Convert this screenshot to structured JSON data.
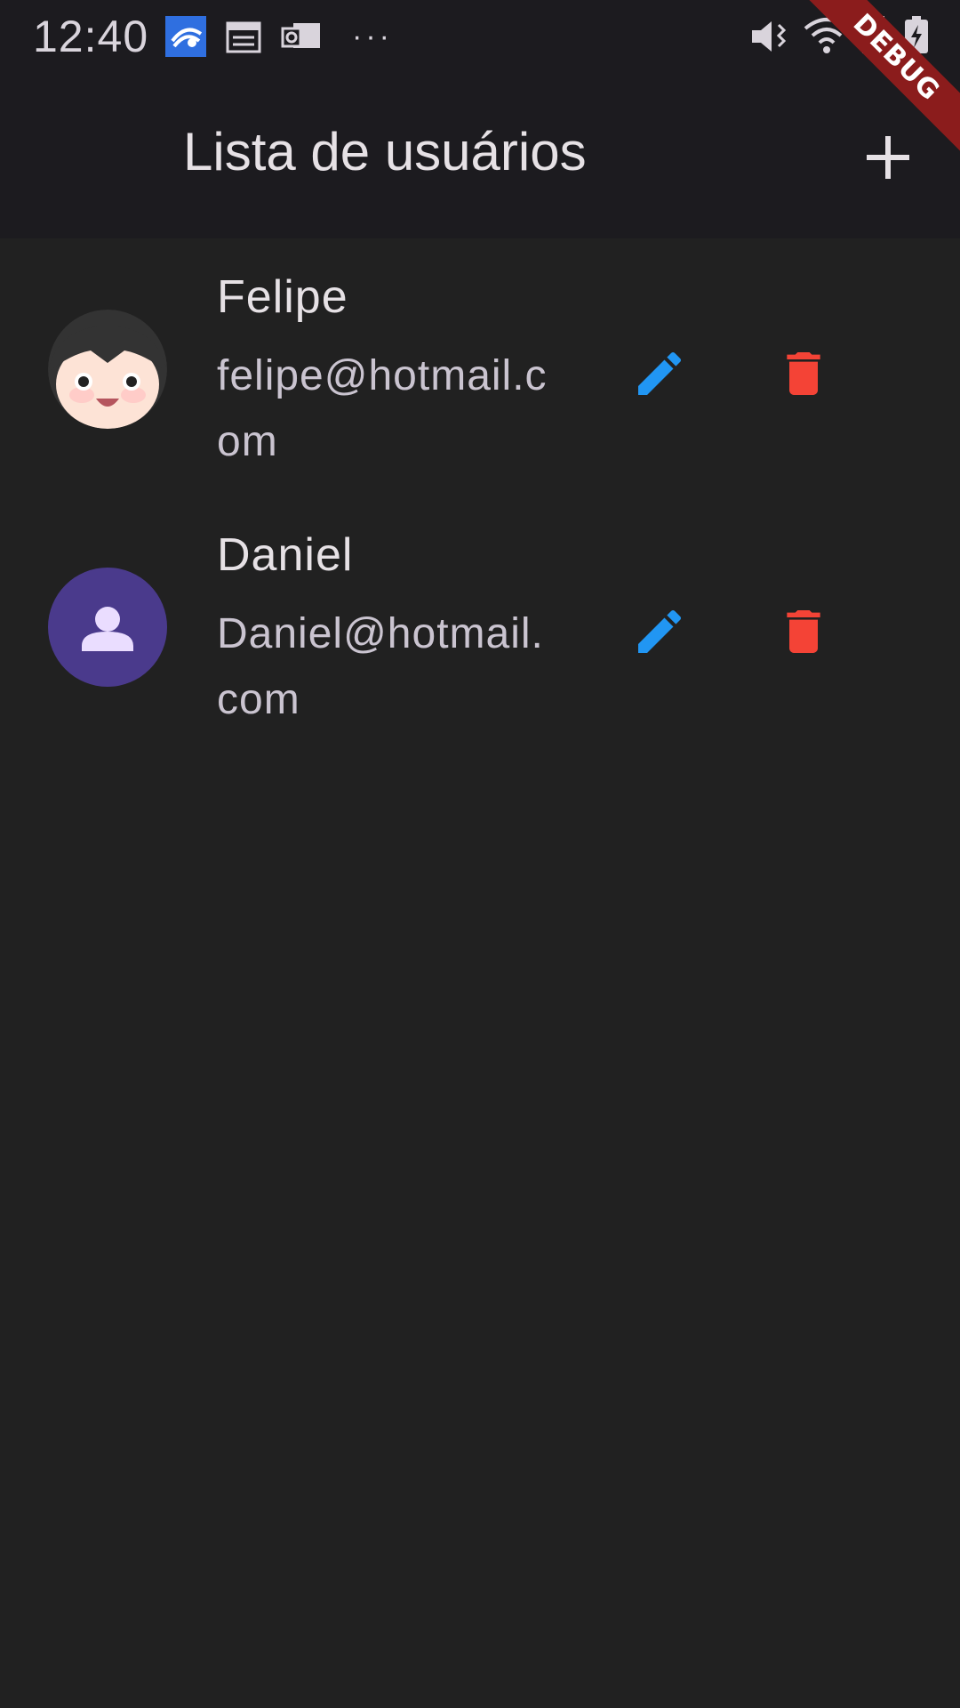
{
  "status_bar": {
    "time": "12:40",
    "left_icons": [
      "browser-app-icon",
      "calendar-icon",
      "outlook-icon",
      "more-dots-icon"
    ],
    "right_icons": [
      "mute-vibrate-icon",
      "wifi-icon",
      "signal-icon",
      "battery-charging-icon"
    ]
  },
  "app_bar": {
    "title": "Lista de usuários",
    "add_icon": "plus-icon"
  },
  "users": [
    {
      "name": "Felipe",
      "email": "felipe@hotmail.com",
      "avatar": "cartoon-face-avatar"
    },
    {
      "name": "Daniel",
      "email": "Daniel@hotmail.com",
      "avatar": "person-icon"
    }
  ],
  "colors": {
    "background": "#212121",
    "app_bar": "#1c1b1f",
    "edit": "#2196f3",
    "delete": "#f44336",
    "avatar_default": "#4a3a8c"
  },
  "debug_banner": {
    "label": "DEBUG"
  }
}
